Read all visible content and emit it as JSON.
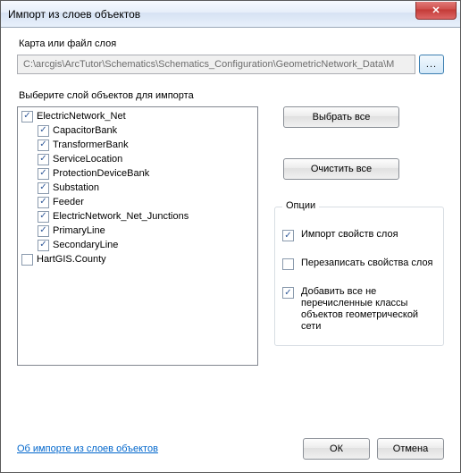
{
  "window": {
    "title": "Импорт из слоев объектов"
  },
  "map_section": {
    "label": "Карта или файл слоя",
    "path": "C:\\arcgis\\ArcTutor\\Schematics\\Schematics_Configuration\\GeometricNetwork_Data\\M",
    "browse_label": "..."
  },
  "layers_section": {
    "label": "Выберите слой объектов для импорта",
    "items": [
      {
        "label": "ElectricNetwork_Net",
        "checked": true,
        "indent": 0
      },
      {
        "label": "CapacitorBank",
        "checked": true,
        "indent": 1
      },
      {
        "label": "TransformerBank",
        "checked": true,
        "indent": 1
      },
      {
        "label": "ServiceLocation",
        "checked": true,
        "indent": 1
      },
      {
        "label": "ProtectionDeviceBank",
        "checked": true,
        "indent": 1
      },
      {
        "label": "Substation",
        "checked": true,
        "indent": 1
      },
      {
        "label": "Feeder",
        "checked": true,
        "indent": 1
      },
      {
        "label": "ElectricNetwork_Net_Junctions",
        "checked": true,
        "indent": 1
      },
      {
        "label": "PrimaryLine",
        "checked": true,
        "indent": 1
      },
      {
        "label": "SecondaryLine",
        "checked": true,
        "indent": 1
      },
      {
        "label": "HartGIS.County",
        "checked": false,
        "indent": 0
      }
    ]
  },
  "side_buttons": {
    "select_all": "Выбрать все",
    "clear_all": "Очистить все"
  },
  "options": {
    "group_title": "Опции",
    "items": [
      {
        "label": "Импорт свойств слоя",
        "checked": true
      },
      {
        "label": "Перезаписать свойства слоя",
        "checked": false
      },
      {
        "label": "Добавить все не перечисленные классы объектов геометрической сети",
        "checked": true
      }
    ]
  },
  "footer": {
    "help_link": "Об импорте из слоев объектов",
    "ok": "ОК",
    "cancel": "Отмена"
  }
}
